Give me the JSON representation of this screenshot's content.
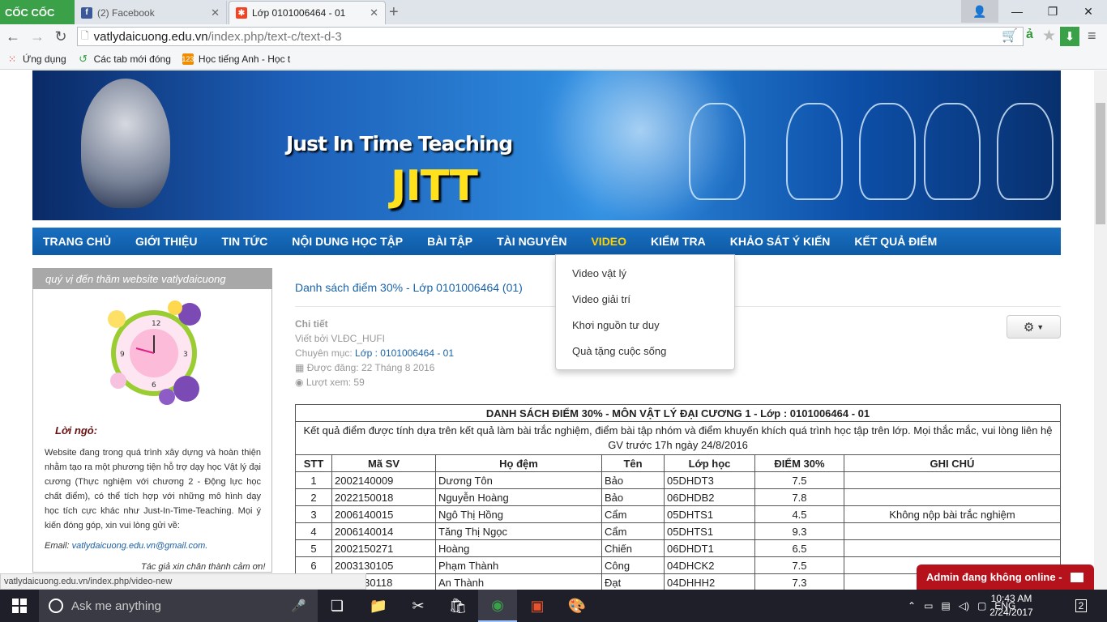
{
  "browser": {
    "logo": "CỐC CỐC",
    "tabs": [
      {
        "title": "(2) Facebook",
        "icon": "facebook-icon"
      },
      {
        "title": "Lớp 0101006464 - 01",
        "icon": "joomla-icon"
      }
    ],
    "url": {
      "domain": "vatlydaicuong.edu.vn",
      "path": "/index.php/text-c/text-d-3"
    },
    "bookmarks": [
      {
        "label": "Ứng dụng",
        "icon": "apps-icon"
      },
      {
        "label": "Các tab mới đóng",
        "icon": "history-icon"
      },
      {
        "label": "Học tiếng Anh - Học t",
        "icon": "123-icon"
      }
    ],
    "status_url": "vatlydaicuong.edu.vn/index.php/video-new"
  },
  "banner": {
    "subtitle": "Just In Time Teaching",
    "title": "JITT"
  },
  "nav": {
    "items": [
      "TRANG CHỦ",
      "GIỚI THIỆU",
      "TIN TỨC",
      "NỘI DUNG HỌC TẬP",
      "BÀI TẬP",
      "TÀI NGUYÊN",
      "VIDEO",
      "KIỂM TRA",
      "KHẢO SÁT Ý KIẾN",
      "KẾT QUẢ ĐIỂM"
    ],
    "active_index": 6,
    "dropdown": [
      "Video vật lý",
      "Video giải trí",
      "Khơi nguồn tư duy",
      "Quà tặng cuộc sống"
    ]
  },
  "sidebar": {
    "marquee": "quý vị đến thăm website vatlydaicuong",
    "heading": "Lời ngỏ:",
    "text": "Website đang trong quá trình xây dựng và hoàn thiện nhằm tạo ra một phương tiện hỗ trợ dạy học Vật lý đại cương (Thực nghiệm với chương 2 - Động lực học chất điểm), có thể tích hợp với những mô hình dạy học tích cực khác như Just-In-Time-Teaching. Mọi ý kiến đóng góp, xin vui lòng gửi về:",
    "email_label": "Email:",
    "email": "vatlydaicuong.edu.vn@gmail.com.",
    "thanks": "Tác giả xin chân thành cảm ơn!"
  },
  "article": {
    "title": "Danh sách điểm 30% - Lớp 0101006464 (01)",
    "details_label": "Chi tiết",
    "author": "Viết bởi VLĐC_HUFI",
    "category_label": "Chuyên mục:",
    "category": "Lớp : 0101006464 - 01",
    "published": "Được đăng: 22 Tháng 8 2016",
    "views": "Lượt xem: 59"
  },
  "table": {
    "title": "DANH SÁCH ĐIỂM 30% - MÔN VẬT LÝ ĐẠI CƯƠNG 1 - Lớp : 0101006464 - 01",
    "description": "Kết quả điểm được tính dựa trên kết quả làm bài trắc nghiệm, điểm bài tập nhóm và điểm khuyến khích quá trình học tập trên lớp. Mọi thắc mắc, vui lòng liên hệ GV trước 17h ngày 24/8/2016",
    "headers": [
      "STT",
      "Mã SV",
      "Họ đệm",
      "Tên",
      "Lớp học",
      "ĐIỂM 30%",
      "GHI CHÚ"
    ],
    "rows": [
      [
        "1",
        "2002140009",
        "Dương Tôn",
        "Bảo",
        "05DHDT3",
        "7.5",
        ""
      ],
      [
        "2",
        "2022150018",
        "Nguyễn Hoàng",
        "Bảo",
        "06DHDB2",
        "7.8",
        ""
      ],
      [
        "3",
        "2006140015",
        "Ngô Thị Hồng",
        "Cẩm",
        "05DHTS1",
        "4.5",
        "Không nộp bài trắc nghiệm"
      ],
      [
        "4",
        "2006140014",
        "Tăng Thị Ngọc",
        "Cẩm",
        "05DHTS1",
        "9.3",
        ""
      ],
      [
        "5",
        "2002150271",
        "Hoàng",
        "Chiến",
        "06DHDT1",
        "6.5",
        ""
      ],
      [
        "6",
        "2003130105",
        "Phạm Thành",
        "Công",
        "04DHCK2",
        "7.5",
        ""
      ],
      [
        "7",
        "2003130118",
        "An Thành",
        "Đạt",
        "04DHHH2",
        "7.3",
        ""
      ]
    ]
  },
  "chat": {
    "label": "Admin đang không online -"
  },
  "taskbar": {
    "search_placeholder": "Ask me anything",
    "language": "ENG",
    "time": "10:43 AM",
    "date": "2/24/2017",
    "notifications": "2"
  }
}
